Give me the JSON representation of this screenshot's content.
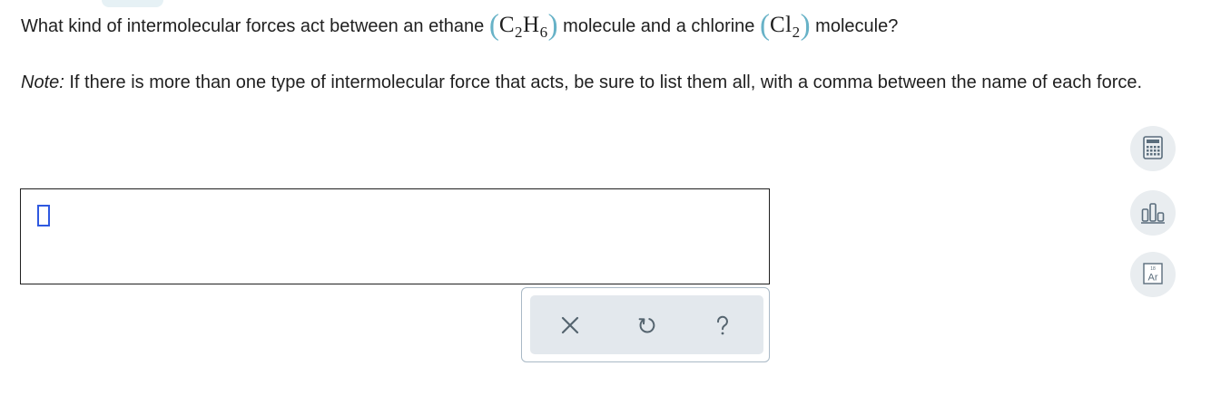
{
  "question": {
    "text_before": "What kind of intermolecular forces act between an ethane",
    "ethane_formula": {
      "c": "C",
      "c_sub": "2",
      "h": "H",
      "h_sub": "6"
    },
    "text_middle": "molecule and a chlorine",
    "chlorine_formula": {
      "cl": "Cl",
      "cl_sub": "2"
    },
    "text_after": "molecule?"
  },
  "note": {
    "label": "Note:",
    "text": "If there is more than one type of intermolecular force that acts, be sure to list them all, with a comma between the name of each force."
  },
  "answer": {
    "value": ""
  },
  "actions": {
    "clear_icon": "x-icon",
    "undo_icon": "undo-icon",
    "help_icon": "question-icon"
  },
  "tools": {
    "calculator_icon": "calculator-icon",
    "data_icon": "bar-chart-icon",
    "periodic_table_icon": "periodic-table-icon",
    "periodic_number": "18",
    "periodic_symbol": "Ar"
  },
  "colors": {
    "paren": "#67b2c7",
    "cursor": "#2f59e0",
    "panel_border": "#a9b9c6",
    "tool_bg": "#e9edf0",
    "tool_icon": "#5a6d7c"
  }
}
